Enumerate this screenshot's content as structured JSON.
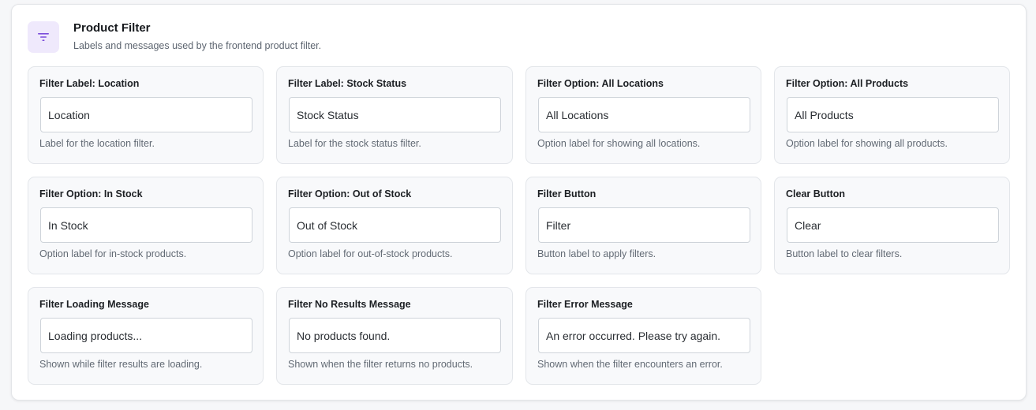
{
  "header": {
    "icon": "filter-icon",
    "accent_color": "#7c4ddb",
    "title": "Product Filter",
    "subtitle": "Labels and messages used by the frontend product filter."
  },
  "fields": [
    {
      "id": "filter-label-location",
      "label": "Filter Label: Location",
      "value": "Location",
      "hint": "Label for the location filter."
    },
    {
      "id": "filter-label-stock-status",
      "label": "Filter Label: Stock Status",
      "value": "Stock Status",
      "hint": "Label for the stock status filter."
    },
    {
      "id": "filter-option-all-locations",
      "label": "Filter Option: All Locations",
      "value": "All Locations",
      "hint": "Option label for showing all locations."
    },
    {
      "id": "filter-option-all-products",
      "label": "Filter Option: All Products",
      "value": "All Products",
      "hint": "Option label for showing all products."
    },
    {
      "id": "filter-option-in-stock",
      "label": "Filter Option: In Stock",
      "value": "In Stock",
      "hint": "Option label for in-stock products."
    },
    {
      "id": "filter-option-out-of-stock",
      "label": "Filter Option: Out of Stock",
      "value": "Out of Stock",
      "hint": "Option label for out-of-stock products."
    },
    {
      "id": "filter-button",
      "label": "Filter Button",
      "value": "Filter",
      "hint": "Button label to apply filters."
    },
    {
      "id": "clear-button",
      "label": "Clear Button",
      "value": "Clear",
      "hint": "Button label to clear filters."
    },
    {
      "id": "filter-loading-message",
      "label": "Filter Loading Message",
      "value": "Loading products...",
      "hint": "Shown while filter results are loading."
    },
    {
      "id": "filter-no-results-message",
      "label": "Filter No Results Message",
      "value": "No products found.",
      "hint": "Shown when the filter returns no products."
    },
    {
      "id": "filter-error-message",
      "label": "Filter Error Message",
      "value": "An error occurred. Please try again.",
      "hint": "Shown when the filter encounters an error."
    }
  ]
}
